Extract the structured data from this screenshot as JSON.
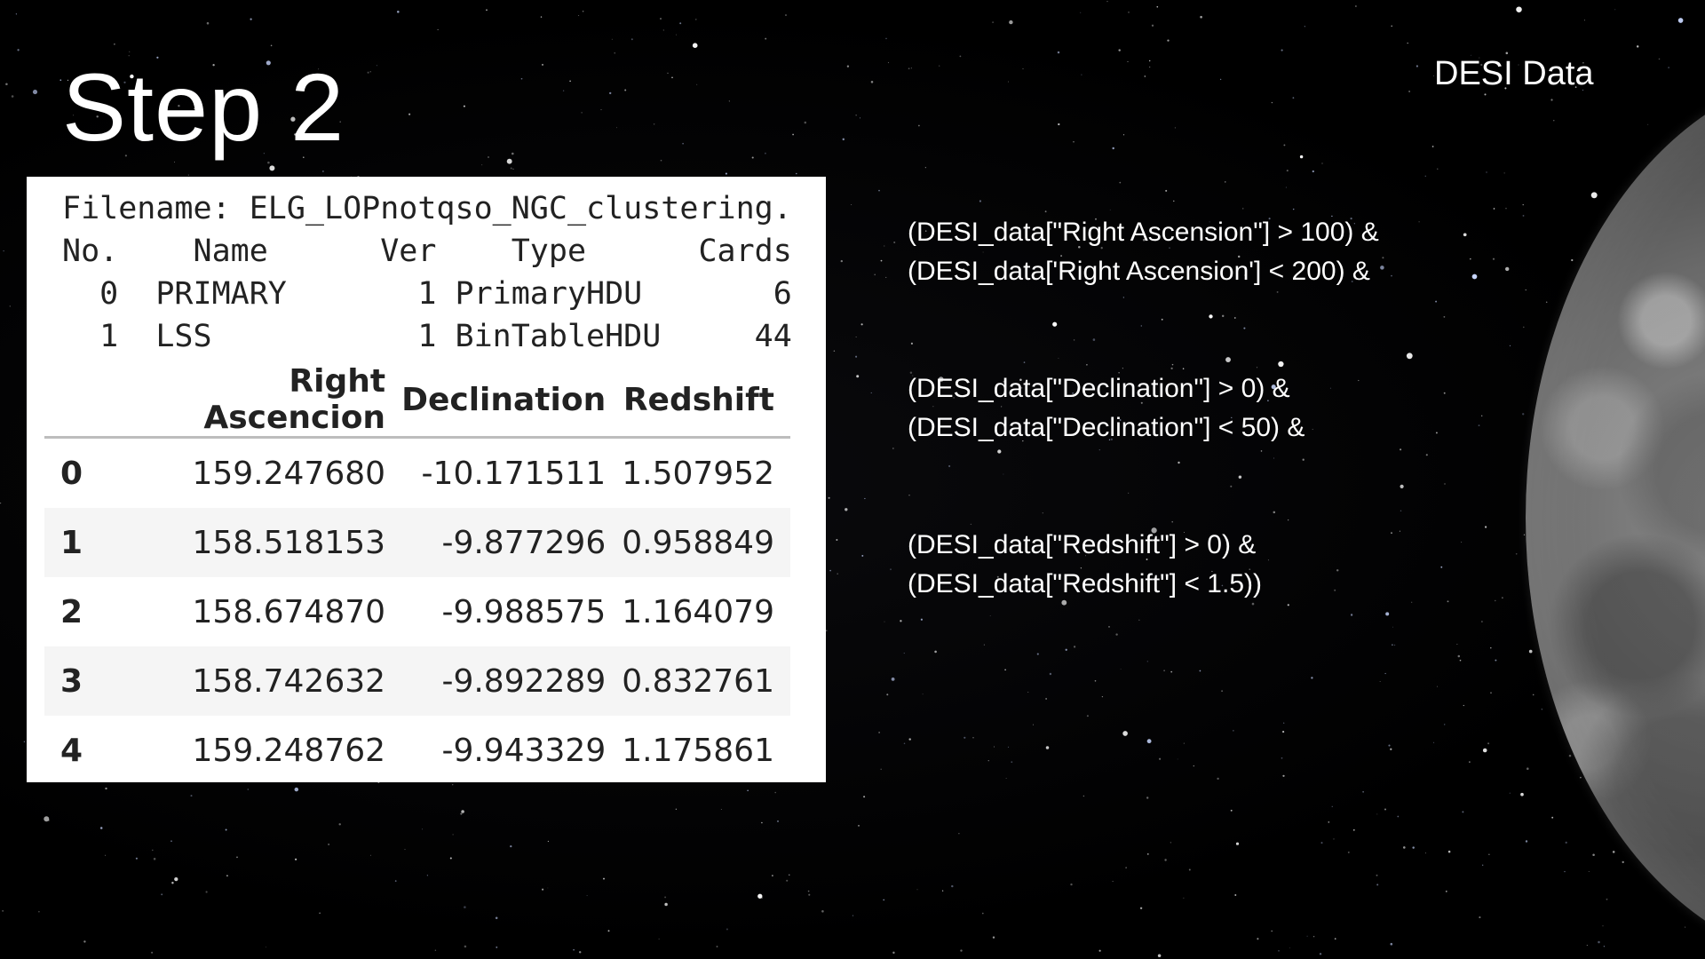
{
  "slide": {
    "title": "Step 2",
    "corner_label": "DESI Data"
  },
  "fits_info": {
    "lines": [
      "Filename: ELG_LOPnotqso_NGC_clustering.",
      "No.    Name      Ver    Type      Cards",
      "  0  PRIMARY       1 PrimaryHDU       6",
      "  1  LSS           1 BinTableHDU     44"
    ]
  },
  "table": {
    "columns": [
      "",
      "Right Ascencion",
      "Declination",
      "Redshift"
    ],
    "rows": [
      {
        "index": "0",
        "ra": "159.247680",
        "dec": "-10.171511",
        "z": "1.507952"
      },
      {
        "index": "1",
        "ra": "158.518153",
        "dec": "-9.877296",
        "z": "0.958849"
      },
      {
        "index": "2",
        "ra": "158.674870",
        "dec": "-9.988575",
        "z": "1.164079"
      },
      {
        "index": "3",
        "ra": "158.742632",
        "dec": "-9.892289",
        "z": "0.832761"
      },
      {
        "index": "4",
        "ra": "159.248762",
        "dec": "-9.943329",
        "z": "1.175861"
      }
    ]
  },
  "conditions": {
    "right_ascension": [
      "(DESI_data[\"Right Ascension\"] > 100) &",
      "(DESI_data['Right Ascension'] < 200) &"
    ],
    "declination": [
      "(DESI_data[\"Declination\"] > 0) &",
      "(DESI_data[\"Declination\"] < 50) &"
    ],
    "redshift": [
      "(DESI_data[\"Redshift\"] > 0) &",
      "(DESI_data[\"Redshift\"] < 1.5))"
    ]
  },
  "colors": {
    "background": "#000000",
    "panel": "#ffffff",
    "row_shade": "#f5f5f5",
    "text_light": "#ffffff"
  }
}
